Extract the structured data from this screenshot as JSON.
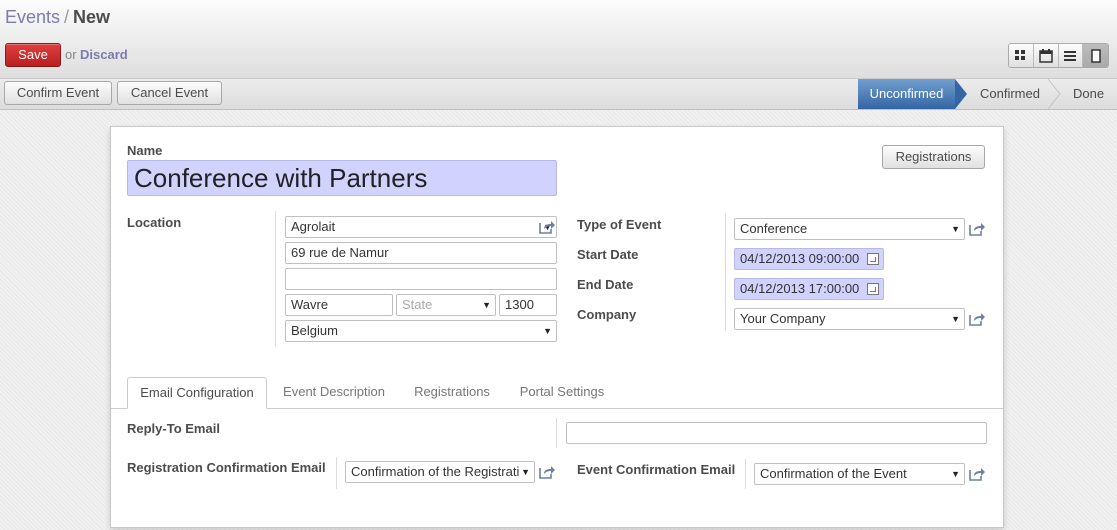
{
  "breadcrumb": {
    "parent": "Events",
    "separator": "/",
    "current": "New"
  },
  "actions": {
    "save": "Save",
    "or": "or",
    "discard": "Discard"
  },
  "views": [
    "kanban-view-icon",
    "calendar-view-icon",
    "list-view-icon",
    "form-view-icon"
  ],
  "statusbar": {
    "buttons": [
      "Confirm Event",
      "Cancel Event"
    ],
    "stages": [
      "Unconfirmed",
      "Confirmed",
      "Done"
    ],
    "active_stage": "Unconfirmed"
  },
  "form": {
    "name_label": "Name",
    "name_value": "Conference with Partners",
    "registrations_button": "Registrations",
    "location_label": "Location",
    "address": {
      "partner": "Agrolait",
      "street": "69 rue de Namur",
      "street2": "",
      "city": "Wavre",
      "state_placeholder": "State",
      "zip": "1300",
      "country": "Belgium"
    },
    "type_label": "Type of Event",
    "type_value": "Conference",
    "start_label": "Start Date",
    "start_value": "04/12/2013 09:00:00",
    "end_label": "End Date",
    "end_value": "04/12/2013 17:00:00",
    "company_label": "Company",
    "company_value": "Your Company"
  },
  "tabs": [
    "Email Configuration",
    "Event Description",
    "Registrations",
    "Portal Settings"
  ],
  "email": {
    "reply_to_label": "Reply-To Email",
    "reply_to_value": "",
    "reg_conf_label": "Registration Confirmation Email",
    "reg_conf_value": "Confirmation of the Registrati",
    "event_conf_label": "Event Confirmation Email",
    "event_conf_value": "Confirmation of the Event"
  },
  "colors": {
    "accent_link": "#7c7bad",
    "save_red": "#c62a2a",
    "stage_blue": "#3465a4",
    "required_bg": "#d2d2ff"
  }
}
